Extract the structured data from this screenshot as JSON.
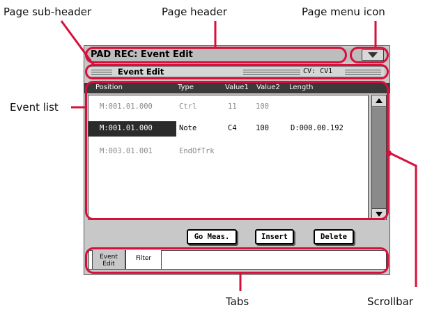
{
  "callouts": {
    "sub_header": "Page sub-header",
    "header": "Page header",
    "menu_icon": "Page menu icon",
    "event_list": "Event list",
    "tabs": "Tabs",
    "scrollbar": "Scrollbar"
  },
  "header": {
    "title": "PAD REC: Event Edit"
  },
  "subheader": {
    "title": "Event Edit",
    "right": "CV: CV1"
  },
  "columns": [
    "Position",
    "Type",
    "Value1",
    "Value2",
    "Length"
  ],
  "events": [
    {
      "position": "M:001.01.000",
      "type": "Ctrl",
      "value1": "11",
      "value2": "100",
      "length": ""
    },
    {
      "position": "M:001.01.000",
      "type": "Note",
      "value1": "C4",
      "value2": "100",
      "length": "D:000.00.192"
    },
    {
      "position": "M:003.01.001",
      "type": "EndOfTrk",
      "value1": "",
      "value2": "",
      "length": ""
    }
  ],
  "buttons": {
    "go_meas": "Go Meas.",
    "insert": "Insert",
    "delete": "Delete"
  },
  "tabs": {
    "event_edit_line1": "Event",
    "event_edit_line2": "Edit",
    "filter": "Filter"
  },
  "colors": {
    "callout_outline": "#d80f3b",
    "selected_row": "#2b2b2b",
    "screen_bg": "#c8c8c8"
  }
}
